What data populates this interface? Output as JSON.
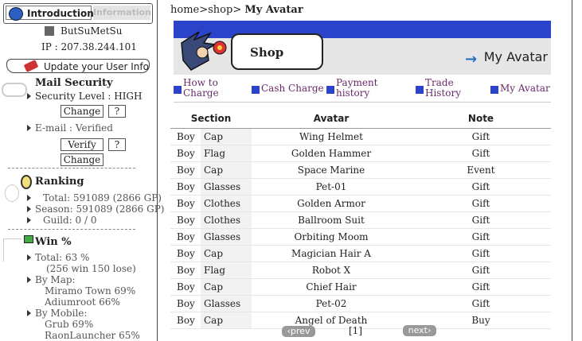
{
  "sidebar": {
    "tabs": {
      "intro": "Introduction",
      "info": "Information"
    },
    "username": "ButSuMetSu",
    "ip": "IP : 207.38.244.101",
    "update_btn": "Update your User Info",
    "mail_security": {
      "title": "Mail Security",
      "security_level": "Security Level : HIGH",
      "change_btn": "Change",
      "help_btn": "?",
      "email": "E-mail : Verified",
      "verify_btn": "Verify",
      "help_btn2": "?",
      "change_btn2": "Change"
    },
    "ranking": {
      "title": "Ranking",
      "total": "Total: 591089 (2866 GP)",
      "season": "Season: 591089 (2866 GP)",
      "guild": "Guild: 0 / 0"
    },
    "win": {
      "title": "Win %",
      "total": "Total: 63 %",
      "total_detail": "(256 win 150 lose)",
      "by_map": "By Map:",
      "map1": "Miramo Town 69%",
      "map2": "Adiumroot 66%",
      "by_mobile": "By Mobile:",
      "mob1": "Grub 69%",
      "mob2": "RaonLauncher 65%"
    }
  },
  "main": {
    "breadcrumb": {
      "home": "home",
      "sep1": ">",
      "shop": "shop",
      "sep2": ">",
      "current": "My Avatar"
    },
    "banner": {
      "shop": "Shop",
      "title": "My Avatar"
    },
    "nav": [
      {
        "label": "How to Charge"
      },
      {
        "label": "Cash Charge"
      },
      {
        "label": "Payment history"
      },
      {
        "label": "Trade History"
      },
      {
        "label": "My Avatar"
      }
    ],
    "table": {
      "headers": [
        "Section",
        "Avatar",
        "Note"
      ],
      "rows": [
        [
          "Boy",
          "Cap",
          "Wing Helmet",
          "Gift"
        ],
        [
          "Boy",
          "Flag",
          "Golden Hammer",
          "Gift"
        ],
        [
          "Boy",
          "Cap",
          "Space Marine",
          "Event"
        ],
        [
          "Boy",
          "Glasses",
          "Pet-01",
          "Gift"
        ],
        [
          "Boy",
          "Clothes",
          "Golden Armor",
          "Gift"
        ],
        [
          "Boy",
          "Clothes",
          "Ballroom Suit",
          "Gift"
        ],
        [
          "Boy",
          "Glasses",
          "Orbiting Moom",
          "Gift"
        ],
        [
          "Boy",
          "Cap",
          "Magician Hair A",
          "Gift"
        ],
        [
          "Boy",
          "Flag",
          "Robot X",
          "Gift"
        ],
        [
          "Boy",
          "Cap",
          "Chief Hair",
          "Gift"
        ],
        [
          "Boy",
          "Glasses",
          "Pet-02",
          "Gift"
        ],
        [
          "Boy",
          "Cap",
          "Angel of Death",
          "Buy"
        ]
      ]
    },
    "pager": {
      "prev": "‹prev",
      "page": "[1]",
      "next": "next›"
    }
  }
}
